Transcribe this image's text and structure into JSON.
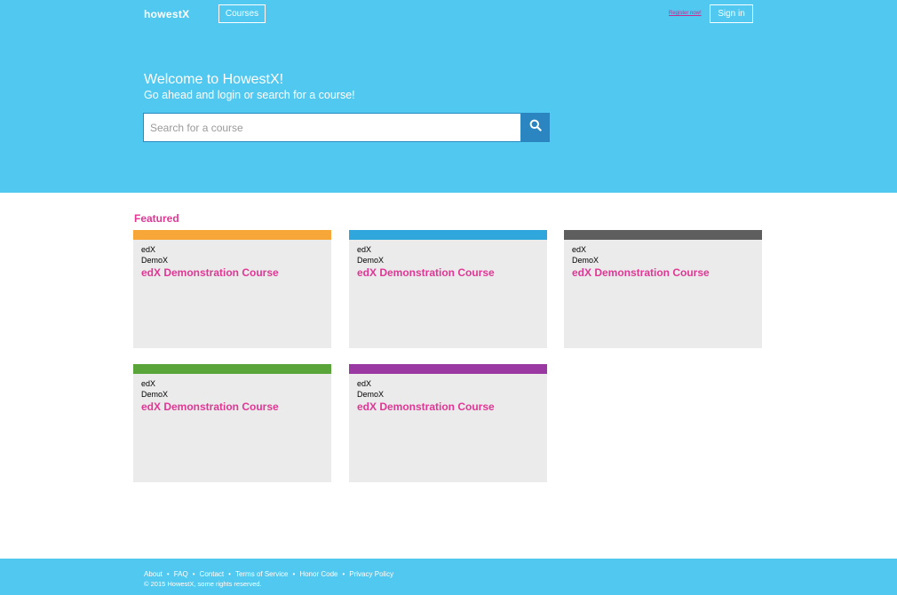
{
  "header": {
    "logo": "howestX",
    "courses_label": "Courses",
    "register_label": "Register now!",
    "signin_label": "Sign in"
  },
  "hero": {
    "title": "Welcome to HowestX!",
    "subtitle": "Go ahead and login or search for a course!",
    "search_placeholder": "Search for a course",
    "search_value": ""
  },
  "featured": {
    "heading": "Featured",
    "cards": [
      {
        "org": "edX",
        "code": "DemoX",
        "title": "edX Demonstration Course",
        "color": "#f6a737"
      },
      {
        "org": "edX",
        "code": "DemoX",
        "title": "edX Demonstration Course",
        "color": "#30a7dc"
      },
      {
        "org": "edX",
        "code": "DemoX",
        "title": "edX Demonstration Course",
        "color": "#5e5e5e"
      },
      {
        "org": "edX",
        "code": "DemoX",
        "title": "edX Demonstration Course",
        "color": "#5aa53a"
      },
      {
        "org": "edX",
        "code": "DemoX",
        "title": "edX Demonstration Course",
        "color": "#9a39a2"
      }
    ]
  },
  "footer": {
    "links": [
      "About",
      "FAQ",
      "Contact",
      "Terms of Service",
      "Honor Code",
      "Privacy Policy"
    ],
    "separator": "•",
    "copyright": "© 2015 HowestX, some rights reserved."
  },
  "colors": {
    "hero_bg": "#50c8ef",
    "accent": "#e03795",
    "search_button": "#2a85c0",
    "card_bg": "#ebebeb"
  },
  "icons": {
    "search": "search-icon"
  }
}
